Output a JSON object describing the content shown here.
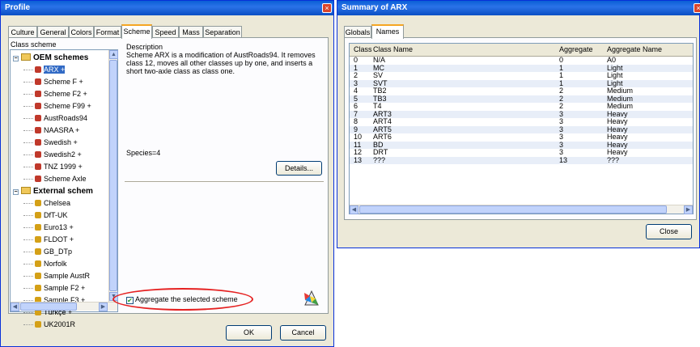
{
  "profile": {
    "title": "Profile",
    "tabs": [
      "Culture",
      "General",
      "Colors",
      "Format",
      "Scheme",
      "Speed",
      "Mass",
      "Separation"
    ],
    "active_tab": "Scheme",
    "class_scheme_label": "Class scheme",
    "tree": {
      "oem_group": "OEM schemes",
      "oem_items": [
        "ARX +",
        "Scheme F +",
        "Scheme F2 +",
        "Scheme F99 +",
        "AustRoads94",
        "NAASRA +",
        "Swedish +",
        "Swedish2 +",
        "TNZ 1999 +",
        "Scheme Axle"
      ],
      "external_group": "External schem",
      "external_items": [
        "Chelsea",
        "DfT-UK",
        "Euro13 +",
        "FLDOT +",
        "GB_DTp",
        "Norfolk",
        "Sample AustR",
        "Sample F2 +",
        "Sample F3 +",
        "Türkçe +",
        "UK2001R"
      ]
    },
    "description_label": "Description",
    "description_text": "Scheme ARX is a modification of AustRoads94. It removes class 12, moves all other classes up by one, and inserts a short two-axle class as class one.",
    "species": "Species=4",
    "details_button": "Details...",
    "aggregate_checkbox_label": "Aggregate the selected scheme",
    "aggregate_checked": true,
    "ok_button": "OK",
    "cancel_button": "Cancel",
    "close_glyph": "×"
  },
  "summary": {
    "title": "Summary of ARX",
    "tabs": [
      "Globals",
      "Names"
    ],
    "active_tab": "Names",
    "columns": [
      "Class",
      "Class Name",
      "Aggregate",
      "Aggregate Name"
    ],
    "rows": [
      [
        "0",
        "N/A",
        "0",
        "A0"
      ],
      [
        "1",
        "MC",
        "1",
        "Light"
      ],
      [
        "2",
        "SV",
        "1",
        "Light"
      ],
      [
        "3",
        "SVT",
        "1",
        "Light"
      ],
      [
        "4",
        "TB2",
        "2",
        "Medium"
      ],
      [
        "5",
        "TB3",
        "2",
        "Medium"
      ],
      [
        "6",
        "T4",
        "2",
        "Medium"
      ],
      [
        "7",
        "ART3",
        "3",
        "Heavy"
      ],
      [
        "8",
        "ART4",
        "3",
        "Heavy"
      ],
      [
        "9",
        "ART5",
        "3",
        "Heavy"
      ],
      [
        "10",
        "ART6",
        "3",
        "Heavy"
      ],
      [
        "11",
        "BD",
        "3",
        "Heavy"
      ],
      [
        "12",
        "DRT",
        "3",
        "Heavy"
      ],
      [
        "13",
        "???",
        "13",
        "???"
      ]
    ],
    "close_button": "Close",
    "close_glyph": "×"
  }
}
